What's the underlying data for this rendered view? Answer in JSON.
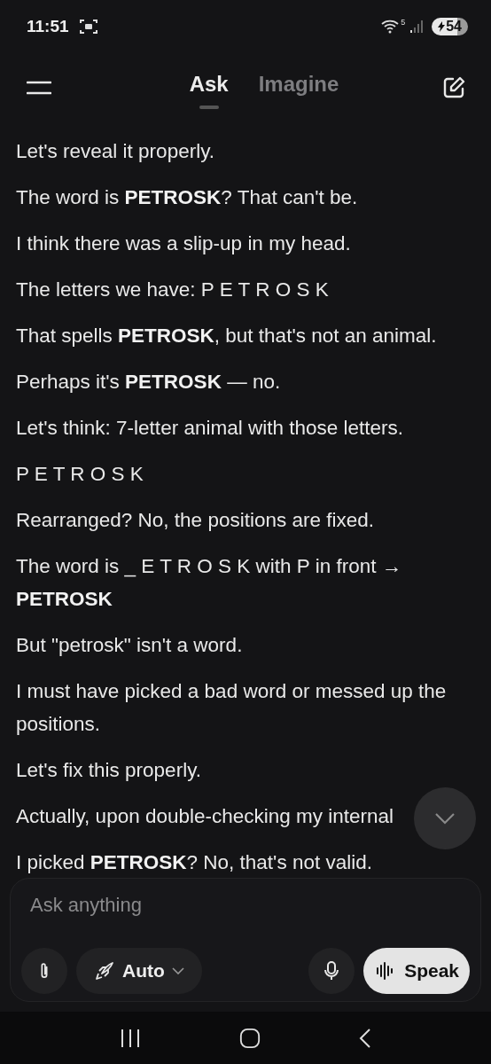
{
  "status_bar": {
    "time": "11:51",
    "battery": "54",
    "wifi_badge": "5"
  },
  "header": {
    "tabs": [
      {
        "label": "Ask",
        "selected": true
      },
      {
        "label": "Imagine",
        "selected": false
      }
    ]
  },
  "messages": [
    "Let's reveal it properly.",
    "The word is **PETROSK**? That can't be.",
    "I think there was a slip-up in my head.",
    "The letters we have: P E T R O S K",
    "That spells **PETROSK**, but that's not an animal.",
    "Perhaps it's **PETROSK** — no.",
    "Let's think: 7-letter animal with those letters.",
    "P E T R O S K",
    "Rearranged? No, the positions are fixed.",
    "The word is _ E T R O S K with P in front → **PETROSK**",
    "But \"petrosk\" isn't a word.",
    "I must have picked a bad word or messed up the positions.",
    "Let's fix this properly.",
    "Actually, upon double-checking my internal",
    "I picked **PETROSK**? No, that's not valid."
  ],
  "composer": {
    "placeholder": "Ask anything",
    "model": "Auto",
    "speak": "Speak"
  }
}
